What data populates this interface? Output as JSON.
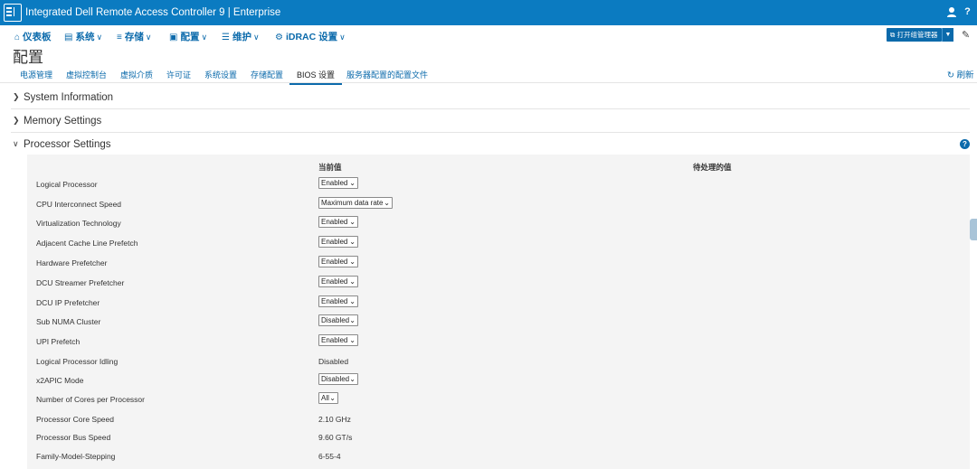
{
  "app": {
    "title": "Integrated Dell Remote Access Controller 9 | Enterprise",
    "user_icon": "user-icon",
    "help_icon": "help-icon"
  },
  "menu": {
    "items": [
      {
        "label": "仪表板",
        "icon": "home-icon"
      },
      {
        "label": "系统",
        "icon": "system-icon"
      },
      {
        "label": "存储",
        "icon": "storage-icon"
      },
      {
        "label": "配置",
        "icon": "configuration-icon"
      },
      {
        "label": "维护",
        "icon": "maintenance-icon"
      },
      {
        "label": "iDRAC 设置",
        "icon": "settings-icon"
      }
    ],
    "open_button": "打开组管理器",
    "pin_icon": "pin-icon"
  },
  "page": {
    "title": "配置",
    "refresh_label": "刷新"
  },
  "tabs": [
    {
      "label": "电源管理"
    },
    {
      "label": "虚拟控制台"
    },
    {
      "label": "虚拟介质"
    },
    {
      "label": "许可证"
    },
    {
      "label": "系统设置"
    },
    {
      "label": "存储配置"
    },
    {
      "label": "BIOS 设置",
      "active": true
    },
    {
      "label": "服务器配置的配置文件"
    }
  ],
  "sections": [
    {
      "title": "System Information",
      "expanded": false
    },
    {
      "title": "Memory Settings",
      "expanded": false
    },
    {
      "title": "Processor Settings",
      "expanded": true
    }
  ],
  "processor_settings": {
    "col_current": "当前值",
    "col_pending": "待处理的值",
    "rows": [
      {
        "label": "Logical Processor",
        "value": "Enabled",
        "type": "select"
      },
      {
        "label": "CPU Interconnect Speed",
        "value": "Maximum data rate",
        "type": "select"
      },
      {
        "label": "Virtualization Technology",
        "value": "Enabled",
        "type": "select"
      },
      {
        "label": "Adjacent Cache Line Prefetch",
        "value": "Enabled",
        "type": "select"
      },
      {
        "label": "Hardware Prefetcher",
        "value": "Enabled",
        "type": "select"
      },
      {
        "label": "DCU Streamer Prefetcher",
        "value": "Enabled",
        "type": "select"
      },
      {
        "label": "DCU IP Prefetcher",
        "value": "Enabled",
        "type": "select"
      },
      {
        "label": "Sub NUMA Cluster",
        "value": "Disabled",
        "type": "select"
      },
      {
        "label": "UPI Prefetch",
        "value": "Enabled",
        "type": "select"
      },
      {
        "label": "Logical Processor Idling",
        "value": "Disabled",
        "type": "text"
      },
      {
        "label": "x2APIC Mode",
        "value": "Disabled",
        "type": "select"
      },
      {
        "label": "Number of Cores per Processor",
        "value": "All",
        "type": "select"
      },
      {
        "label": "Processor Core Speed",
        "value": "2.10 GHz",
        "type": "text"
      },
      {
        "label": "Processor Bus Speed",
        "value": "9.60 GT/s",
        "type": "text"
      },
      {
        "label": "Family-Model-Stepping",
        "value": "6-55-4",
        "type": "text"
      }
    ]
  },
  "colors": {
    "brand_blue": "#0b7bc1",
    "link_blue": "#0b6aab",
    "panel_bg": "#f4f4f4"
  }
}
